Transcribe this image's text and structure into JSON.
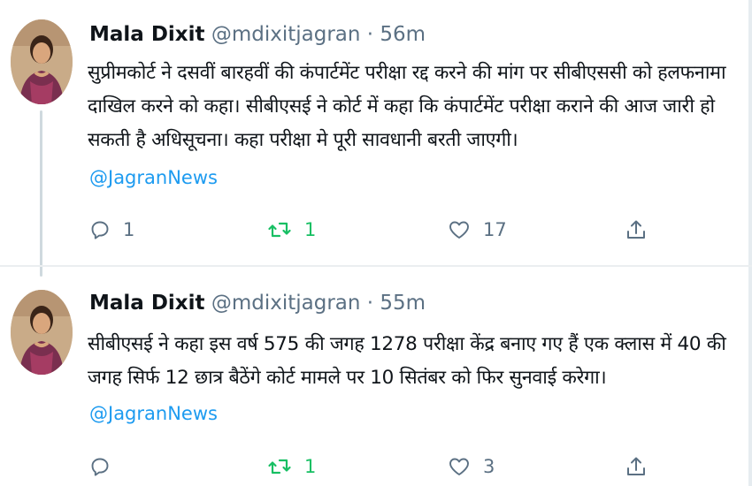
{
  "colors": {
    "accent": "#1d9bf0",
    "retweet": "#17bf63",
    "muted": "#5b7083"
  },
  "tweets": [
    {
      "author_name": "Mala Dixit",
      "handle": "@mdixitjagran",
      "separator": "·",
      "time": "56m",
      "text": "सुप्रीमकोर्ट ने दसवीं बारहवीं की कंपार्टमेंट परीक्षा रद्द करने की मांग पर सीबीएससी को हलफनामा दाखिल करने को कहा। सीबीएसई ने कोर्ट में कहा कि कंपार्टमेंट परीक्षा कराने की आज जारी हो सकती है अधिसूचना। कहा परीक्षा मे पूरी सावधानी बरती जाएगी।",
      "mention": "@JagranNews",
      "replies": "1",
      "retweets": "1",
      "likes": "17"
    },
    {
      "author_name": "Mala Dixit",
      "handle": "@mdixitjagran",
      "separator": "·",
      "time": "55m",
      "text": "सीबीएसई ने कहा इस वर्ष 575 की जगह 1278 परीक्षा केंद्र बनाए गए हैं एक क्लास में 40 की जगह सिर्फ 12 छात्र बैठेंगे कोर्ट मामले पर 10 सितंबर को फिर सुनवाई करेगा।",
      "mention": "@JagranNews",
      "replies": "",
      "retweets": "1",
      "likes": "3"
    }
  ],
  "icons": {
    "reply": "reply-icon",
    "retweet": "retweet-icon",
    "like": "heart-icon",
    "share": "share-icon"
  }
}
